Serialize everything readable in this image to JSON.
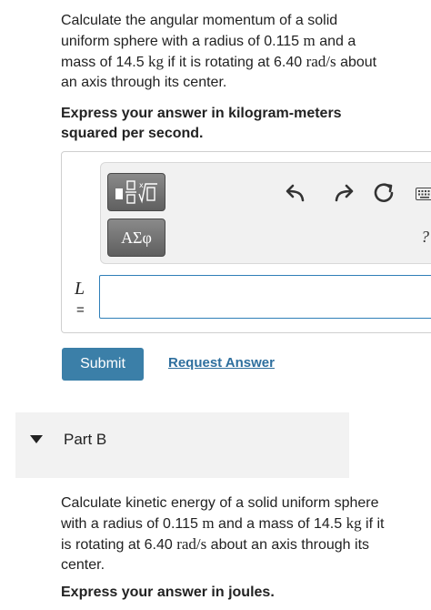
{
  "part_a": {
    "question_parts": [
      "Calculate the angular momentum of a solid uniform sphere with a radius of 0.115 ",
      "m",
      " and a mass of 14.5 ",
      "kg",
      " if it is rotating at 6.40 ",
      "rad/s",
      " about an axis through its center."
    ],
    "instruction": "Express your answer in kilogram-meters squared per second.",
    "toolbar": {
      "greek_label": "ΑΣφ",
      "help_label": "?"
    },
    "answer_label": "L",
    "equals_label": "=",
    "answer_value": "",
    "submit_label": "Submit",
    "request_answer_label": "Request Answer"
  },
  "part_b": {
    "title": "Part B",
    "question_parts": [
      "Calculate kinetic energy of a solid uniform sphere with a radius of 0.115 ",
      "m",
      " and a mass of 14.5 ",
      "kg",
      " if it is rotating at 6.40 ",
      "rad/s",
      " about an axis through its center."
    ],
    "instruction": "Express your answer in joules."
  },
  "colors": {
    "submit_bg": "#3b7fa8",
    "link": "#2e6f9e",
    "input_border": "#2f7fb8"
  }
}
